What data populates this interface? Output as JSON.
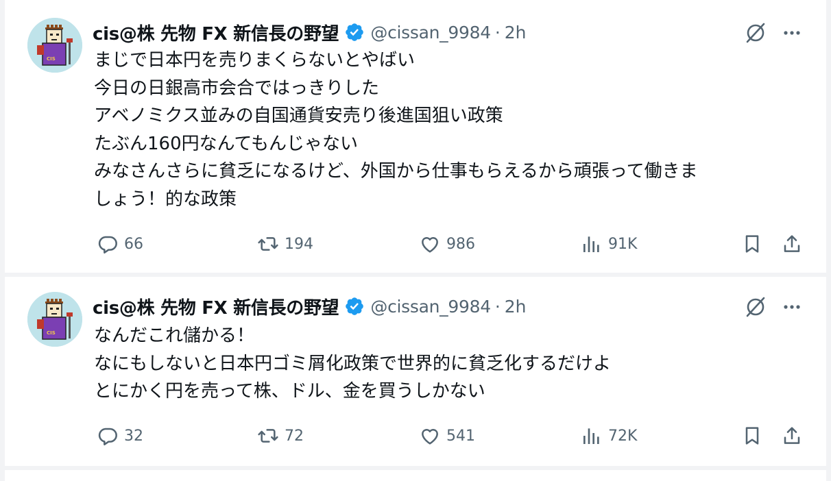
{
  "colors": {
    "background": "#f2f3f5",
    "card": "#ffffff",
    "text_primary": "#0f1419",
    "text_secondary": "#536471",
    "verified": "#1d9bf0",
    "avatar_bg": "#bfe3ea"
  },
  "tweets": [
    {
      "author": {
        "display_name": "cis@株 先物 FX 新信長の野望",
        "handle": "@cissan_9984",
        "verified": true
      },
      "separator": "·",
      "time": "2h",
      "text_lines": [
        "まじで日本円を売りまくらないとやばい",
        "今日の日銀高市会合ではっきりした",
        "アベノミクス並みの自国通貨安売り後進国狙い政策",
        "たぶん160円なんてもんじゃない",
        "みなさんさらに貧乏になるけど、外国から仕事もらえるから頑張って働きま",
        "しょう！的な政策"
      ],
      "stats": {
        "replies": "66",
        "retweets": "194",
        "likes": "986",
        "views": "91K"
      }
    },
    {
      "author": {
        "display_name": "cis@株 先物 FX 新信長の野望",
        "handle": "@cissan_9984",
        "verified": true
      },
      "separator": "·",
      "time": "2h",
      "text_lines": [
        "なんだこれ儲かる！",
        "なにもしないと日本円ゴミ屑化政策で世界的に貧乏化するだけよ",
        "とにかく円を売って株、ドル、金を買うしかない"
      ],
      "stats": {
        "replies": "32",
        "retweets": "72",
        "likes": "541",
        "views": "72K"
      }
    }
  ],
  "icons": {
    "reply": "reply-icon",
    "retweet": "retweet-icon",
    "like": "like-icon",
    "views": "views-icon",
    "bookmark": "bookmark-icon",
    "share": "share-icon",
    "grok": "grok-icon",
    "more": "more-icon",
    "verified": "verified-badge-icon"
  }
}
